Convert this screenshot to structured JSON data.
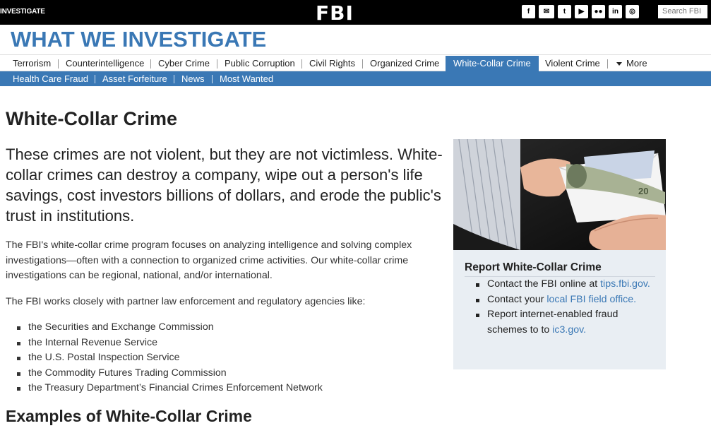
{
  "topbar": {
    "section_label": "INVESTIGATE",
    "logo": "FBI",
    "social": [
      {
        "icon": "facebook-icon",
        "glyph": "f"
      },
      {
        "icon": "email-icon",
        "glyph": "✉"
      },
      {
        "icon": "twitter-icon",
        "glyph": "t"
      },
      {
        "icon": "youtube-icon",
        "glyph": "▶"
      },
      {
        "icon": "flickr-icon",
        "glyph": "●●"
      },
      {
        "icon": "linkedin-icon",
        "glyph": "in"
      },
      {
        "icon": "instagram-icon",
        "glyph": "◎"
      }
    ],
    "search_placeholder": "Search FBI"
  },
  "page_title": "WHAT WE INVESTIGATE",
  "nav_primary": [
    {
      "label": "Terrorism",
      "active": false
    },
    {
      "label": "Counterintelligence",
      "active": false
    },
    {
      "label": "Cyber Crime",
      "active": false
    },
    {
      "label": "Public Corruption",
      "active": false
    },
    {
      "label": "Civil Rights",
      "active": false
    },
    {
      "label": "Organized Crime",
      "active": false
    },
    {
      "label": "White-Collar Crime",
      "active": true
    },
    {
      "label": "Violent Crime",
      "active": false
    },
    {
      "label": "More",
      "active": false
    }
  ],
  "nav_secondary": [
    "Health Care Fraud",
    "Asset Forfeiture",
    "News",
    "Most Wanted"
  ],
  "content": {
    "heading": "White-Collar Crime",
    "lead": "These crimes are not violent, but they are not victimless. White-collar crimes can destroy a company, wipe out a person's life savings, cost investors billions of dollars, and erode the public's trust in institutions.",
    "paragraph1": "The FBI's white-collar crime program focuses on analyzing intelligence and solving complex investigations—often with a connection to organized crime activities. Our white-collar crime investigations can be regional, national, and/or international.",
    "paragraph2": "The FBI works closely with partner law enforcement and regulatory agencies like:",
    "agencies": [
      "the Securities and Exchange Commission",
      "the Internal Revenue Service",
      "the U.S. Postal Inspection Service",
      "the Commodity Futures Trading Commission",
      "the Treasury Department’s Financial Crimes Enforcement Network"
    ],
    "examples_heading": "Examples of White-Collar Crime"
  },
  "sidebar": {
    "report_title": "Report White-Collar Crime",
    "item1_text": "Contact the FBI online at",
    "item1_link": "tips.fbi.gov.",
    "item2_text": "Contact your",
    "item2_link": "local FBI field office.",
    "item3_text": "Report internet-enabled fraud schemes to to",
    "item3_link": "ic3.gov."
  },
  "colors": {
    "brand_blue": "#3a78b5",
    "topbar": "#000000",
    "report_bg": "#e9eef3"
  }
}
